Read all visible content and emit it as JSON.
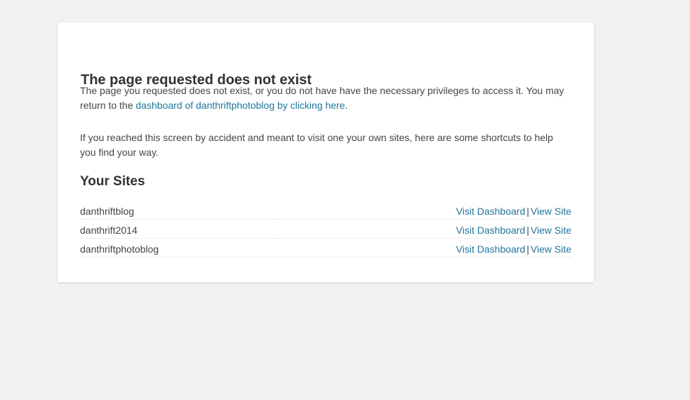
{
  "error": {
    "title": "The page requested does not exist",
    "para1_text": "The page you requested does not exist, or you do not have have the necessary privileges to access it. You may return to the ",
    "para1_link": "dashboard of danthriftphotoblog by clicking here",
    "para1_end": ".",
    "para2_text": "If you reached this screen by accident and meant to visit one your own sites, here are some shortcuts to help you find your way."
  },
  "sites": {
    "heading": "Your Sites",
    "separator": "|",
    "items": [
      {
        "name": "danthriftblog",
        "dashboard_label": "Visit Dashboard",
        "view_label": "View Site"
      },
      {
        "name": "danthrift2014",
        "dashboard_label": "Visit Dashboard",
        "view_label": "View Site"
      },
      {
        "name": "danthriftphotoblog",
        "dashboard_label": "Visit Dashboard",
        "view_label": "View Site"
      }
    ]
  },
  "colors": {
    "page_bg": "#f1f1f1",
    "card_bg": "#ffffff",
    "link": "#21759b",
    "text": "#444444"
  }
}
